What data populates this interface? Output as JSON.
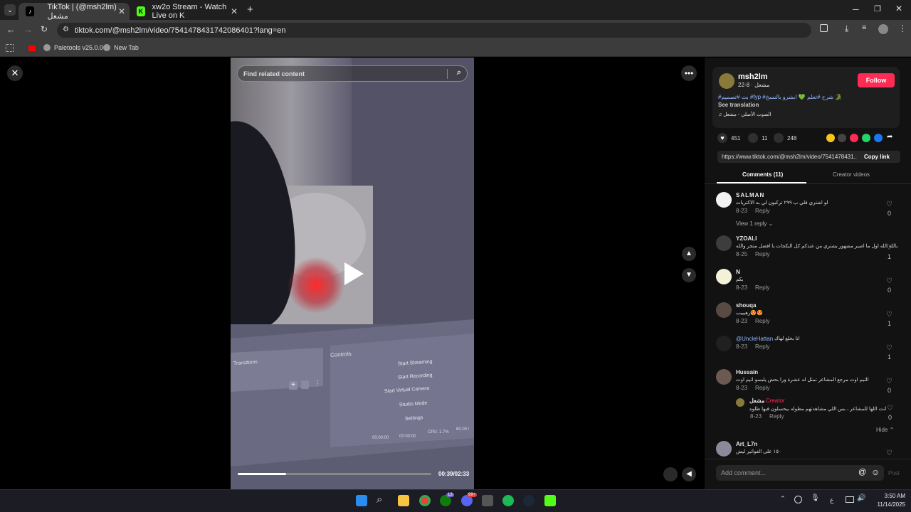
{
  "browser": {
    "tabs": [
      {
        "label": "TikTok | (@msh2lm) مشعل",
        "close": "✕"
      },
      {
        "label": "xw2o Stream - Watch Live on K",
        "close": "✕"
      }
    ],
    "new_tab": "+",
    "url": "tiktok.com/@msh2lm/video/7541478431742086401?lang=en",
    "bookmarks": [
      "Paletools v25.0.0",
      "New Tab"
    ]
  },
  "video": {
    "search_placeholder": "Find related content",
    "time": "00:39/02:33",
    "progress": 0.25,
    "obs_panel": {
      "header": "Controls",
      "section": "Transitions",
      "buttons": [
        "Start Streaming",
        "Start Recording",
        "Start Virtual Camera",
        "Studio Mode",
        "Settings"
      ],
      "stats": [
        "00:00:00",
        "00:00:00",
        "CPU: 1.7%",
        "60.00 /"
      ]
    }
  },
  "author": {
    "name": "msh2lm",
    "sub": "مشعل · 8-22",
    "follow": "Follow",
    "caption": "#بث #تصميم #fyp #شرح #تعلم 💚 ابشرو بالنسخ 🐊",
    "translate": "See translation",
    "sound": "♫ الصوت الأصلي - مشعل"
  },
  "actions": {
    "likes": "451",
    "comments": "11",
    "saves": "248"
  },
  "link": {
    "url": "https://www.tiktok.com/@msh2lm/video/7541478431...",
    "copy": "Copy link"
  },
  "tabs": {
    "comments": "Comments (11)",
    "creator": "Creator videos"
  },
  "comments": [
    {
      "name": "SALMAN",
      "text": "لو اشتري قلي ب ٢٩٩ تركبون لي به الاكتريات",
      "date": "8-23",
      "reply": "Reply",
      "likes": "0",
      "view": "View 1 reply ⌄",
      "color": "#f2f2f2"
    },
    {
      "name": "YZOALI",
      "text": "بالله الله اول ما اصير مشهور بشتري من عندكم كل البكجات يا افضل متجر والله",
      "date": "8-25",
      "reply": "Reply",
      "likes": "1",
      "color": "#3d3d3d"
    },
    {
      "name": "N",
      "text": "بكم",
      "date": "8-23",
      "reply": "Reply",
      "likes": "0",
      "color": "#f5f1d9"
    },
    {
      "name": "shouqa",
      "text": "رهيييب😍😍",
      "date": "8-23",
      "reply": "Reply",
      "likes": "1",
      "color": "#5a4a44"
    },
    {
      "name": "@UncleHattan",
      "text": "انا بخلع لهاك",
      "date": "8-23",
      "reply": "Reply",
      "likes": "1",
      "color": "#202020"
    },
    {
      "name": "Hussain",
      "text": "الثيم اوت مرجع المشاعر تمثل له عشرة ورا بحش يلبسو اثيم اوت",
      "date": "8-23",
      "reply": "Reply",
      "likes": "0",
      "color": "#6c5a52"
    },
    {
      "name": "Art_L7n",
      "text": "١٥٠ على الفواتير ليش",
      "date": "",
      "reply": "",
      "likes": "",
      "color": "#8a8a9a"
    }
  ],
  "creator_reply": {
    "name": "مشعل",
    "tag": "· Creator",
    "text": "انت اللها للمشاعر ، بس اللي مشاهدتهم مطوله بيحسلون فيها طلوه",
    "date": "8-23",
    "reply": "Reply",
    "likes": "0",
    "hide": "Hide ⌃"
  },
  "comment_input": {
    "placeholder": "Add comment...",
    "post": "Post"
  },
  "taskbar": {
    "time": "3:50 AM",
    "date": "11/14/2025",
    "lang": "ع",
    "badge1": "13",
    "badge2": "99+"
  },
  "colors": {
    "accent": "#fe2c55",
    "bg": "#000000",
    "panel": "#121212"
  }
}
